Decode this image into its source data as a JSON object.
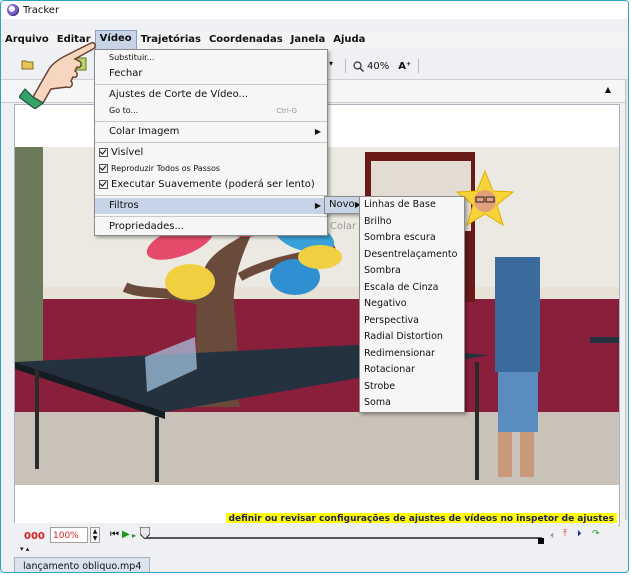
{
  "window": {
    "title": "Tracker"
  },
  "menubar": {
    "items": [
      {
        "label": "Arquivo",
        "name": "menu-arquivo"
      },
      {
        "label": "Editar",
        "name": "menu-editar"
      },
      {
        "label": "Vídeo",
        "name": "menu-video",
        "active": true
      },
      {
        "label": "Trajetórias",
        "name": "menu-trajetorias"
      },
      {
        "label": "Coordenadas",
        "name": "menu-coordenadas"
      },
      {
        "label": "Janela",
        "name": "menu-janela"
      },
      {
        "label": "Ajuda",
        "name": "menu-ajuda"
      }
    ]
  },
  "toolbar": {
    "zoom_label": "40%",
    "font_up": "A⁺"
  },
  "video_menu": {
    "substituir": "Substituir...",
    "fechar": "Fechar",
    "ajustes": "Ajustes de Corte de Vídeo...",
    "goto": "Go to...",
    "goto_shortcut": "Ctrl-G",
    "colar_imagem": "Colar Imagem",
    "visivel": "Visível",
    "reproduzir": "Reproduzir Todos os Passos",
    "executar": "Executar Suavemente (poderá ser lento)",
    "filtros": "Filtros",
    "propriedades": "Propriedades...",
    "colar": "Colar"
  },
  "filtros_menu": {
    "novo": "Novo"
  },
  "novo_menu": {
    "items": [
      "Linhas de Base",
      "Brilho",
      "Sombra escura",
      "Desentrelaçamento",
      "Sombra",
      "Escala de Cinza",
      "Negativo",
      "Perspectiva",
      "Radial Distortion",
      "Redimensionar",
      "Rotacionar",
      "Strobe",
      "Soma"
    ]
  },
  "video": {
    "hint": "definir ou revisar configurações de ajustes de vídeos no inspetor de ajustes"
  },
  "player": {
    "frame": "000",
    "speed": "100%"
  },
  "bottom_tab": {
    "label": "lançamento obliquo.mp4"
  }
}
